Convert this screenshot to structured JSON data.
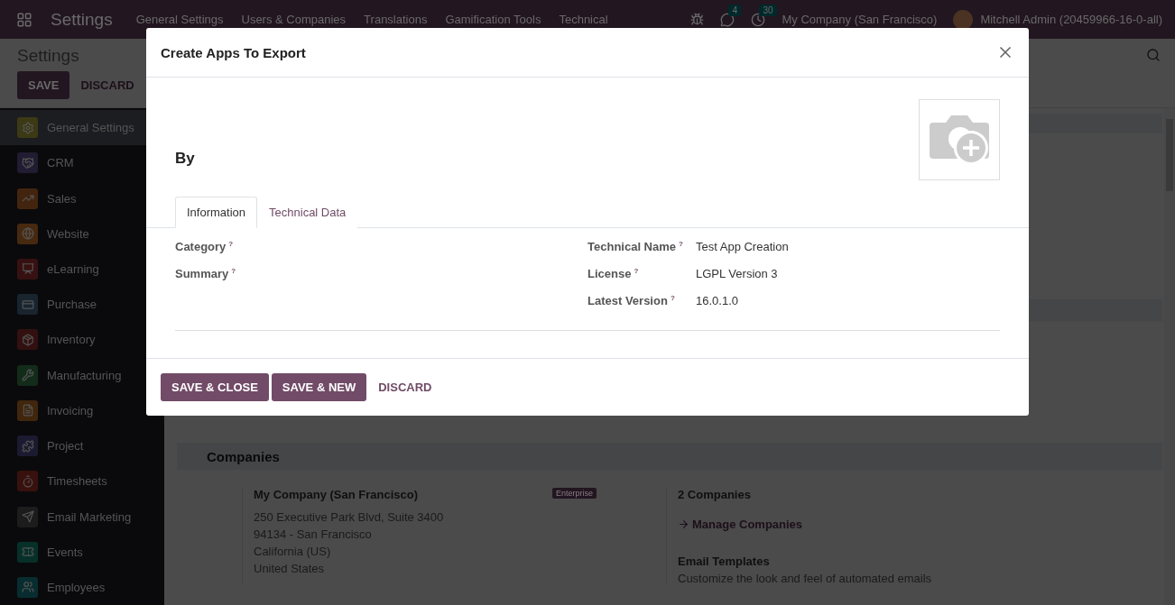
{
  "navbar": {
    "app": "Settings",
    "menu": [
      "General Settings",
      "Users & Companies",
      "Translations",
      "Gamification Tools",
      "Technical"
    ],
    "messages_count": "4",
    "activities_count": "30",
    "company": "My Company (San Francisco)",
    "user": "Mitchell Admin (20459966-16-0-all)"
  },
  "control_panel": {
    "title": "Settings",
    "save": "SAVE",
    "discard": "DISCARD"
  },
  "sidebar": {
    "items": [
      {
        "label": "General Settings",
        "color": "#3c3915",
        "selected": true
      },
      {
        "label": "CRM",
        "color": "#211c31",
        "selected": false
      },
      {
        "label": "Sales",
        "color": "#43250f",
        "selected": false
      },
      {
        "label": "Website",
        "color": "#47290f",
        "selected": false
      },
      {
        "label": "eLearning",
        "color": "#371111",
        "selected": false
      },
      {
        "label": "Purchase",
        "color": "#18252f",
        "selected": false
      },
      {
        "label": "Inventory",
        "color": "#321010",
        "selected": false
      },
      {
        "label": "Manufacturing",
        "color": "#132c1a",
        "selected": false
      },
      {
        "label": "Invoicing",
        "color": "#40260d",
        "selected": false
      },
      {
        "label": "Project",
        "color": "#1c1a30",
        "selected": false
      },
      {
        "label": "Timesheets",
        "color": "#38110e",
        "selected": false
      },
      {
        "label": "Email Marketing",
        "color": "#1c1c1c",
        "selected": false
      },
      {
        "label": "Events",
        "color": "#063029",
        "selected": false
      },
      {
        "label": "Employees",
        "color": "#082d30",
        "selected": false
      }
    ]
  },
  "companies": {
    "title": "Companies",
    "company_name": "My Company (San Francisco)",
    "badge": "Enterprise",
    "address": [
      "250 Executive Park Blvd, Suite 3400",
      "94134 - San Francisco",
      "California (US)",
      "United States"
    ],
    "count": "2 Companies",
    "manage_link": "Manage Companies",
    "email_templates_title": "Email Templates",
    "email_templates_text": "Customize the look and feel of automated emails"
  },
  "dialog": {
    "title": "Create Apps To Export",
    "name": "By",
    "tabs": [
      {
        "label": "Information",
        "selected": true
      },
      {
        "label": "Technical Data",
        "selected": false
      }
    ],
    "left_fields": [
      {
        "label": "Category",
        "help": "?"
      },
      {
        "label": "Summary",
        "help": "?"
      }
    ],
    "right_fields": [
      {
        "label": "Technical Name",
        "help": "?",
        "value": "Test App Creation"
      },
      {
        "label": "License",
        "help": "?",
        "value": "LGPL Version 3"
      },
      {
        "label": "Latest Version",
        "help": "?",
        "value": "16.0.1.0"
      }
    ],
    "buttons": [
      {
        "label": "SAVE & CLOSE",
        "kind": "primary"
      },
      {
        "label": "SAVE & NEW",
        "kind": "primary"
      },
      {
        "label": "DISCARD",
        "kind": "link"
      }
    ]
  }
}
